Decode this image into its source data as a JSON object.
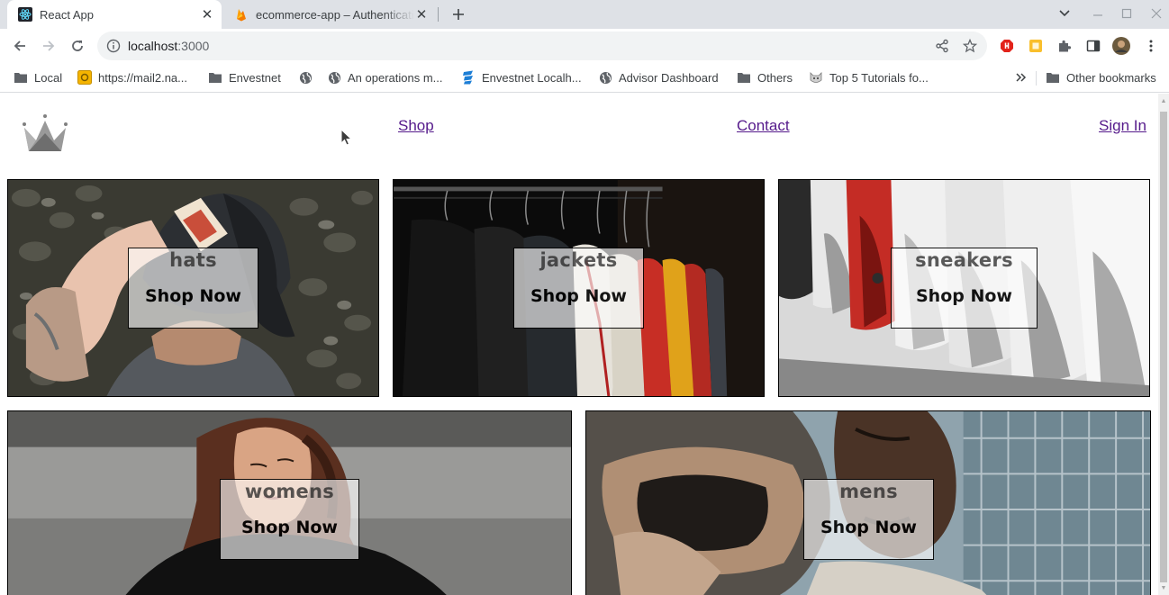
{
  "browser": {
    "tabs": [
      {
        "title": "React App",
        "active": true
      },
      {
        "title": "ecommerce-app – Authentication",
        "active": false
      }
    ],
    "url_host": "localhost",
    "url_port": ":3000",
    "bookmarks": [
      {
        "label": "Local",
        "icon": "folder-icon"
      },
      {
        "label": "https://mail2.na...",
        "icon": "mail-icon"
      },
      {
        "label": "Envestnet",
        "icon": "folder-icon"
      },
      {
        "label": "",
        "icon": "globe-icon"
      },
      {
        "label": "An operations m...",
        "icon": "globe-icon"
      },
      {
        "label": "Envestnet Localh...",
        "icon": "envestnet-icon"
      },
      {
        "label": "Advisor Dashboard",
        "icon": "globe-icon"
      },
      {
        "label": "Others",
        "icon": "folder-icon"
      },
      {
        "label": "Top 5 Tutorials fo...",
        "icon": "cat-icon"
      },
      {
        "label": "Other bookmarks",
        "icon": "folder-icon"
      }
    ]
  },
  "page": {
    "nav": {
      "shop": "Shop",
      "contact": "Contact",
      "signin": "Sign In"
    },
    "categories": [
      {
        "title": "hats",
        "cta": "Shop Now"
      },
      {
        "title": "jackets",
        "cta": "Shop Now"
      },
      {
        "title": "sneakers",
        "cta": "Shop Now"
      },
      {
        "title": "womens",
        "cta": "Shop Now"
      },
      {
        "title": "mens",
        "cta": "Shop Now"
      }
    ]
  },
  "colors": {
    "tabstrip": "#dee1e6",
    "link": "#551a8b",
    "overlay": "rgba(255,255,255,0.7)"
  }
}
